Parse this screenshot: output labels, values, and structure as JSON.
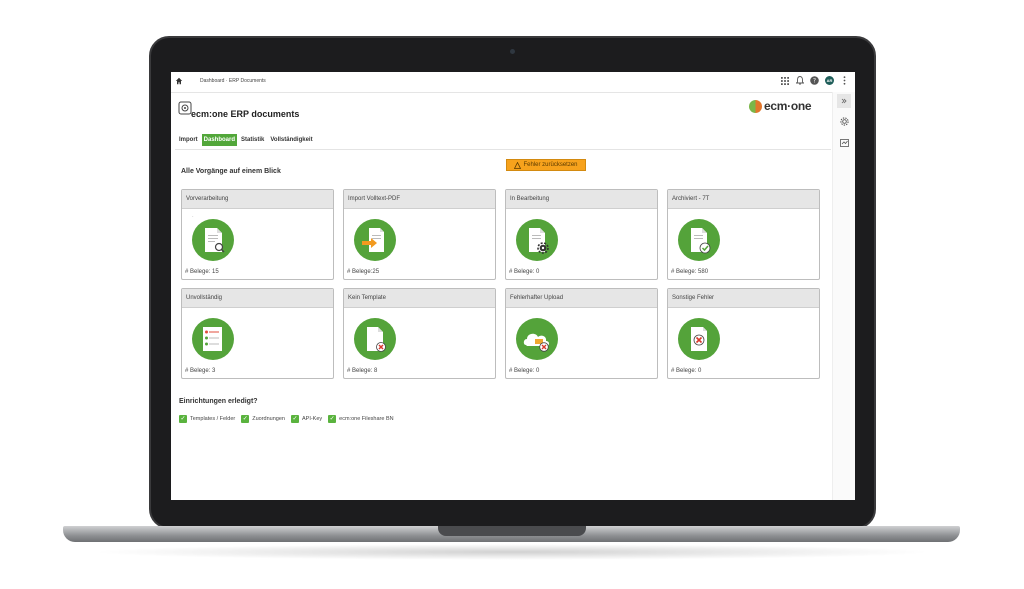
{
  "breadcrumb": "Dashboard · ERP Documents",
  "app": {
    "title": "ecm:one ERP documents",
    "brand": "ecm·one"
  },
  "user": {
    "initials": "AR"
  },
  "tabs": [
    {
      "label": "Import",
      "active": false
    },
    {
      "label": "Dashboard",
      "active": true
    },
    {
      "label": "Statistik",
      "active": false
    },
    {
      "label": "Vollständigkeit",
      "active": false
    }
  ],
  "reset_button": "Fehler zurücksetzen",
  "overview_title": "Alle Vorgänge auf einem Blick",
  "cards": [
    {
      "title": "Vorverarbeitung",
      "count": "# Belege: 15",
      "icon": "document-search-icon"
    },
    {
      "title": "Import Volltext-PDF",
      "count": "# Belege:25",
      "icon": "document-import-icon"
    },
    {
      "title": "In Bearbeitung",
      "count": "# Belege: 0",
      "icon": "document-gear-icon"
    },
    {
      "title": "Archiviert - 7T",
      "count": "# Belege: 580",
      "icon": "document-check-icon"
    },
    {
      "title": "Unvollständig",
      "count": "# Belege: 3",
      "icon": "checklist-icon"
    },
    {
      "title": "Kein Template",
      "count": "# Belege: 8",
      "icon": "document-error-icon"
    },
    {
      "title": "Fehlerhafter Upload",
      "count": "# Belege: 0",
      "icon": "cloud-error-icon"
    },
    {
      "title": "Sonstige Fehler",
      "count": "# Belege: 0",
      "icon": "document-x-icon"
    }
  ],
  "setup": {
    "title": "Einrichtungen erledigt?",
    "items": [
      "Templates / Felder",
      "Zuordnungen",
      "API-Key",
      "ecm:one Fileshare BN"
    ]
  },
  "colors": {
    "accent": "#52a73a",
    "warning": "#f7a21c"
  }
}
